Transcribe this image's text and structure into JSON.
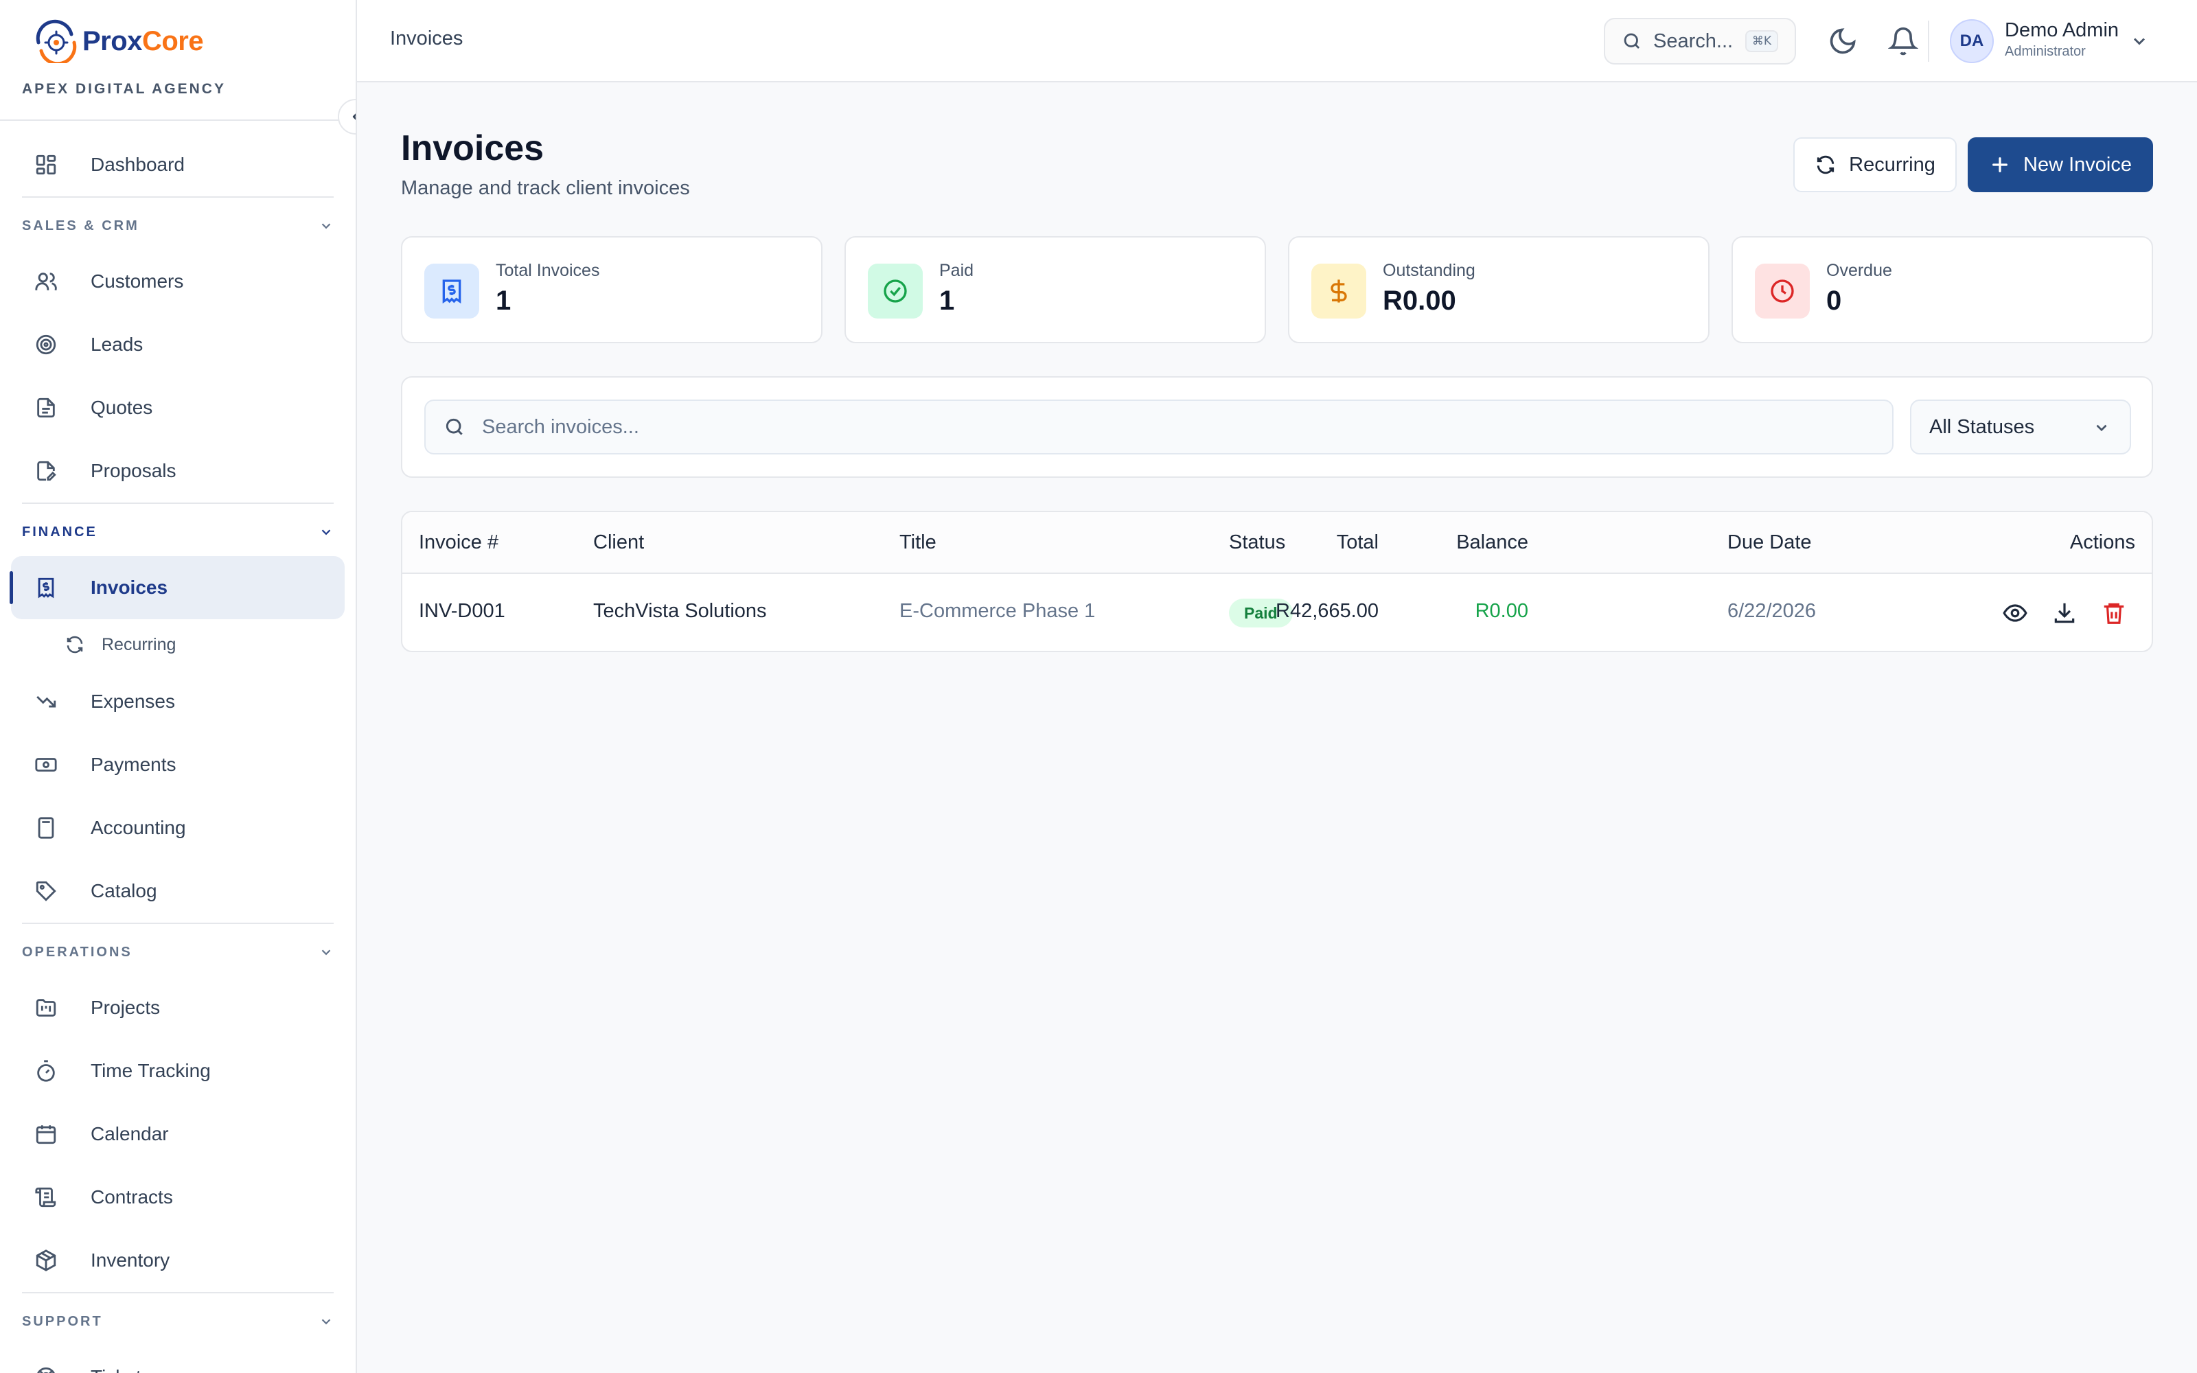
{
  "brand": {
    "name_part1": "Prox",
    "name_part2": "Core",
    "agency": "APEX DIGITAL AGENCY"
  },
  "sidebar": {
    "dashboard": "Dashboard",
    "sales_crm": {
      "title": "SALES & CRM",
      "items": [
        "Customers",
        "Leads",
        "Quotes",
        "Proposals"
      ]
    },
    "finance": {
      "title": "FINANCE",
      "items": [
        "Invoices",
        "Recurring",
        "Expenses",
        "Payments",
        "Accounting",
        "Catalog"
      ]
    },
    "operations": {
      "title": "OPERATIONS",
      "items": [
        "Projects",
        "Time Tracking",
        "Calendar",
        "Contracts",
        "Inventory"
      ]
    },
    "support": {
      "title": "SUPPORT",
      "items": [
        "Tickets"
      ]
    }
  },
  "header": {
    "breadcrumb": "Invoices",
    "search_label": "Search...",
    "search_shortcut": "⌘K",
    "user_initials": "DA",
    "user_name": "Demo Admin",
    "user_role": "Administrator"
  },
  "page": {
    "title": "Invoices",
    "subtitle": "Manage and track client invoices",
    "recurring_button": "Recurring",
    "new_invoice_button": "New Invoice"
  },
  "stats": [
    {
      "label": "Total Invoices",
      "value": "1"
    },
    {
      "label": "Paid",
      "value": "1"
    },
    {
      "label": "Outstanding",
      "value": "R0.00"
    },
    {
      "label": "Overdue",
      "value": "0"
    }
  ],
  "filters": {
    "search_placeholder": "Search invoices...",
    "status_selected": "All Statuses"
  },
  "table": {
    "columns": [
      "Invoice #",
      "Client",
      "Title",
      "Status",
      "Total",
      "Balance",
      "Due Date",
      "Actions"
    ],
    "rows": [
      {
        "invoice": "INV-D001",
        "client": "TechVista Solutions",
        "title": "E-Commerce Phase 1",
        "status": "Paid",
        "total": "R42,665.00",
        "balance": "R0.00",
        "due": "6/22/2026"
      }
    ]
  },
  "colors": {
    "primary": "#1e4b8f",
    "brand_navy": "#1e3a8a",
    "brand_orange": "#f97316",
    "paid_green": "#16a34a",
    "danger_red": "#dc2626"
  },
  "icons": {
    "sidebar": [
      "grid-icon",
      "users-icon",
      "target-icon",
      "file-text-icon",
      "edit-file-icon",
      "receipt-icon",
      "refresh-icon",
      "trending-down-icon",
      "banknote-icon",
      "calculator-icon",
      "tag-icon",
      "folder-kanban-icon",
      "timer-icon",
      "calendar-icon",
      "scroll-icon",
      "package-icon",
      "life-buoy-icon"
    ],
    "header": [
      "search-icon",
      "moon-icon",
      "bell-icon",
      "chevron-down-icon"
    ],
    "actions": [
      "eye-icon",
      "download-icon",
      "trash-icon"
    ]
  }
}
